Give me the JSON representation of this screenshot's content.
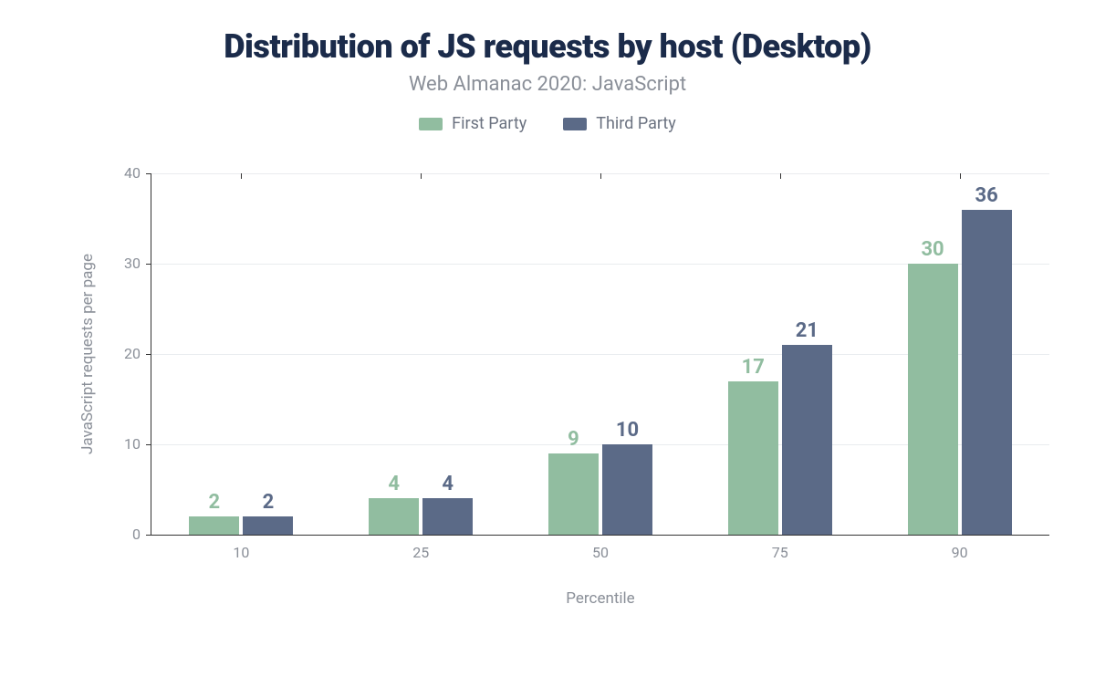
{
  "chart_data": {
    "type": "bar",
    "title": "Distribution of JS requests by host (Desktop)",
    "subtitle": "Web Almanac 2020: JavaScript",
    "xlabel": "Percentile",
    "ylabel": "JavaScript requests per page",
    "categories": [
      "10",
      "25",
      "50",
      "75",
      "90"
    ],
    "series": [
      {
        "name": "First Party",
        "color": "#91bda0",
        "values": [
          2,
          4,
          9,
          17,
          30
        ]
      },
      {
        "name": "Third Party",
        "color": "#5b6a87",
        "values": [
          2,
          4,
          10,
          21,
          36
        ]
      }
    ],
    "y_ticks": [
      0,
      10,
      20,
      30,
      40
    ],
    "ylim": [
      0,
      40
    ]
  }
}
